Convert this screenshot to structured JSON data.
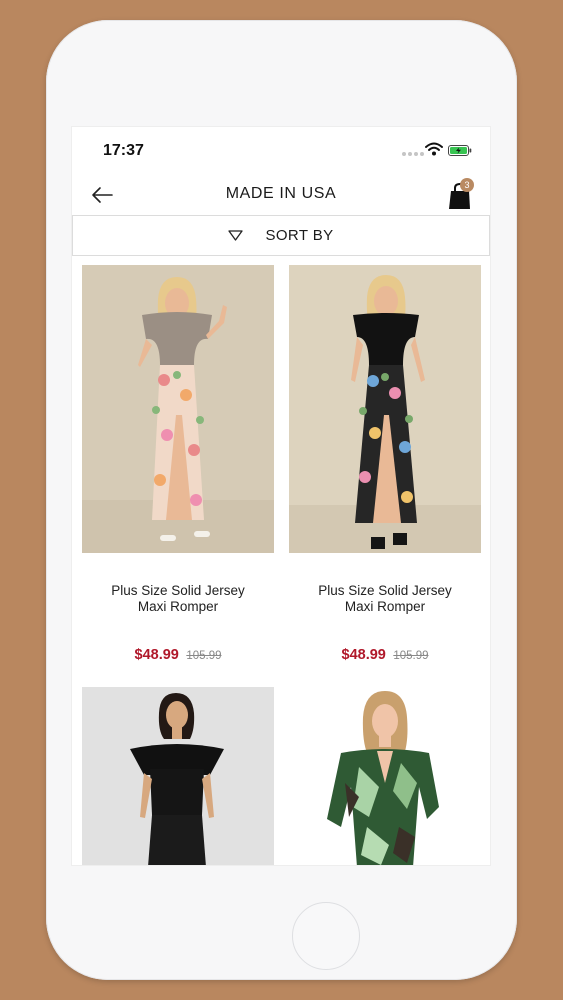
{
  "status_bar": {
    "time": "17:37",
    "icons": [
      "signal-dots-icon",
      "wifi-icon",
      "battery-charging-icon"
    ]
  },
  "header": {
    "title": "MADE IN USA",
    "back_icon": "arrow-left-icon",
    "cart_icon": "shopping-bag-icon",
    "cart_count": "3"
  },
  "sort": {
    "label": "SORT BY",
    "icon": "triangle-down-icon"
  },
  "products": [
    {
      "name_line1": "Plus Size Solid Jersey",
      "name_line2": "Maxi Romper",
      "sale_price": "$48.99",
      "original_price": "105.99"
    },
    {
      "name_line1": "Plus Size Solid Jersey",
      "name_line2": "Maxi Romper",
      "sale_price": "$48.99",
      "original_price": "105.99"
    },
    {
      "name_line1": "",
      "name_line2": "",
      "sale_price": "",
      "original_price": ""
    },
    {
      "name_line1": "",
      "name_line2": "",
      "sale_price": "",
      "original_price": ""
    }
  ],
  "colors": {
    "background": "#b9875f",
    "sale_price": "#b0182a",
    "badge": "#b98a62",
    "battery": "#38c452"
  }
}
